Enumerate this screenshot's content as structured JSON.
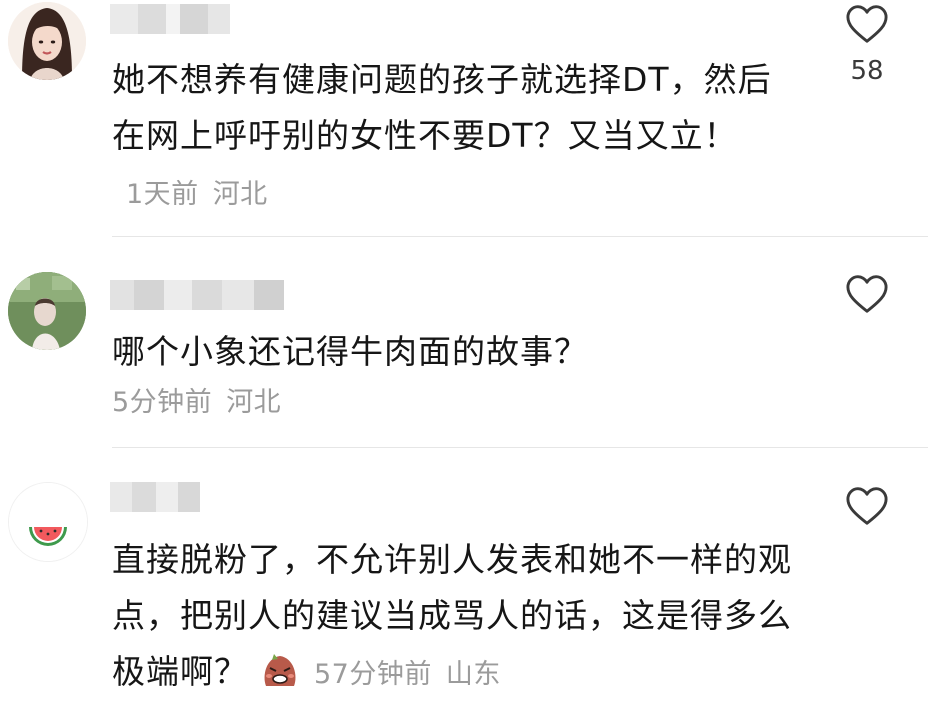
{
  "comments": [
    {
      "avatar": "girl-portrait-avatar",
      "text": "她不想养有健康问题的孩子就选择DT，然后在网上呼吁别的女性不要DT？又当又立！",
      "time": "1天前",
      "location": "河北",
      "likes": "58"
    },
    {
      "avatar": "photo-avatar",
      "text": "哪个小象还记得牛肉面的故事？",
      "time": "5分钟前",
      "location": "河北",
      "likes": ""
    },
    {
      "avatar": "watermelon-avatar",
      "text": "直接脱粉了，不允许别人发表和她不一样的观点，把别人的建议当成骂人的话，这是得多么极端啊？",
      "sticker": "angry-face-emoji",
      "time": "57分钟前",
      "location": "山东",
      "likes": ""
    }
  ],
  "colors": {
    "text": "#161616",
    "meta": "#9b9b9b",
    "divider": "#e6e6e6",
    "icon": "#3a3a3a"
  }
}
